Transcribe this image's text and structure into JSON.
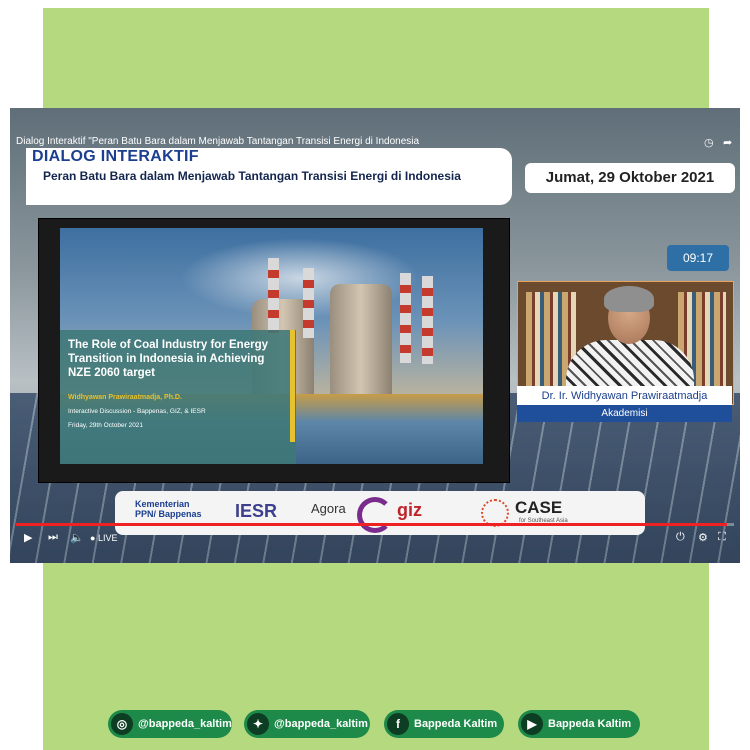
{
  "youtube": {
    "title": "Dialog Interaktif \"Peran Batu Bara dalam Menjawab Tantangan Transisi Energi di Indonesia",
    "live_label": "LIVE"
  },
  "overlay": {
    "title": "DIALOG INTERAKTIF",
    "subtitle": "Peran Batu Bara dalam Menjawab Tantangan Transisi Energi di Indonesia",
    "date": "Jumat, 29 Oktober 2021",
    "timer": "09:17"
  },
  "slide": {
    "title": "The Role of Coal Industry for Energy Transition in Indonesia in Achieving NZE 2060 target",
    "author": "Widhyawan Prawiraatmadja, Ph.D.",
    "event": "Interactive Discussion - Bappenas, GIZ, & IESR",
    "date": "Friday, 29th October 2021"
  },
  "speaker": {
    "name": "Dr. Ir. Widhyawan Prawiraatmadja",
    "role": "Akademisi"
  },
  "logos": [
    "Kementerian PPN/ Bappenas",
    "IESR",
    "Agora",
    "giz",
    "CASE"
  ],
  "logo_subtext": {
    "case": "for Southeast Asia"
  },
  "social": [
    {
      "icon": "instagram-icon",
      "label": "@bappeda_kaltim"
    },
    {
      "icon": "twitter-icon",
      "label": "@bappeda_kaltim"
    },
    {
      "icon": "facebook-icon",
      "label": "Bappeda Kaltim"
    },
    {
      "icon": "youtube-icon",
      "label": "Bappeda Kaltim"
    }
  ],
  "colors": {
    "frame_green": "#b5d97f",
    "title_blue": "#1b3f8f",
    "social_green": "#1e8a4a",
    "timer_blue": "#2e6fa6"
  }
}
